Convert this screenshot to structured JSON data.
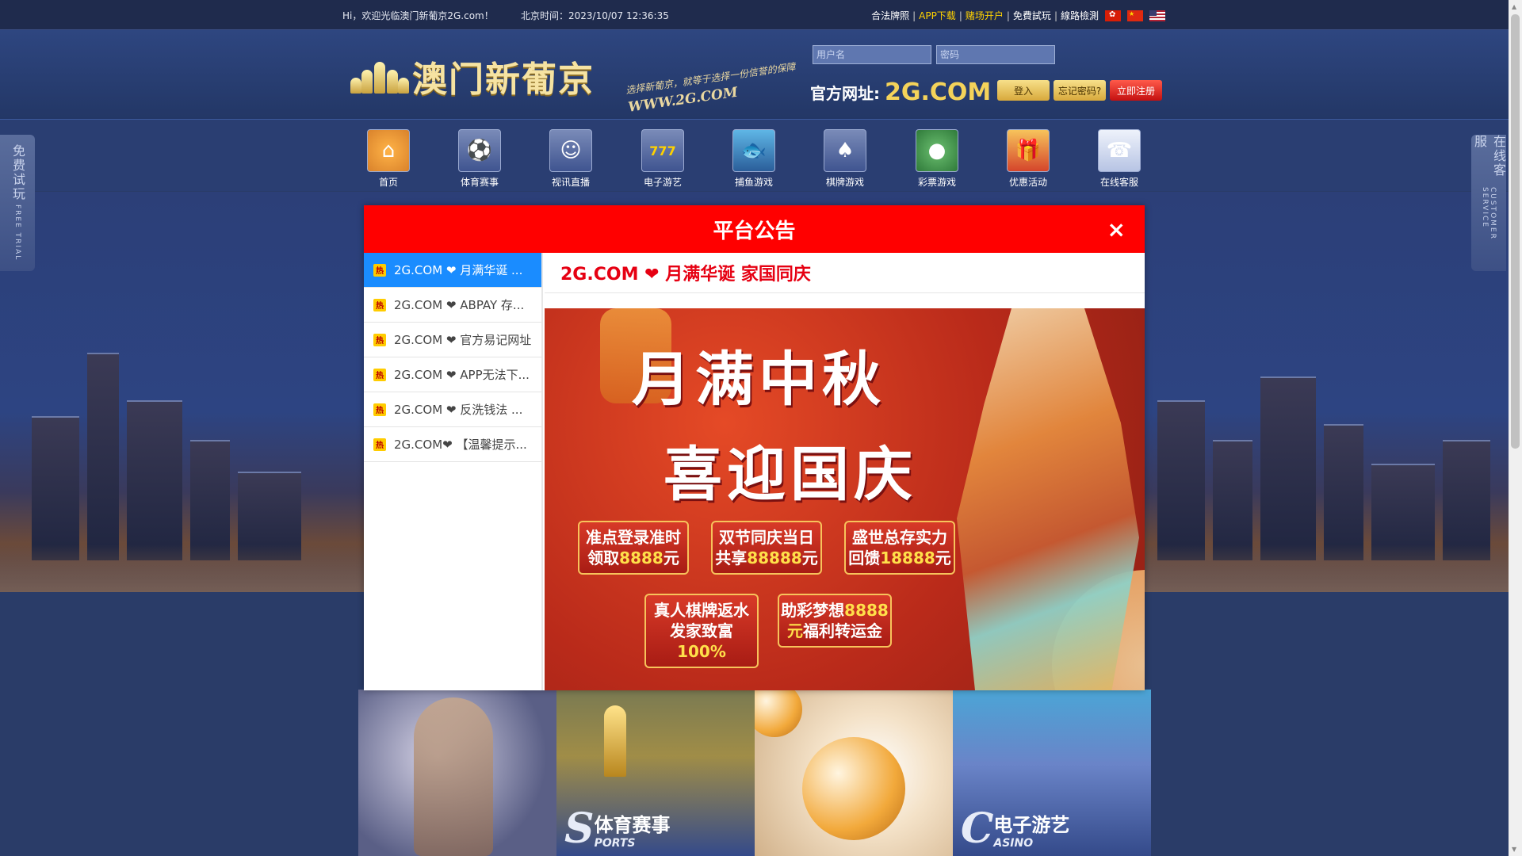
{
  "topbar": {
    "welcome": "Hi，欢迎光临澳门新葡京2G.com！",
    "time": "北京时间：2023/10/07 12:36:35",
    "links": [
      {
        "label": "合法牌照",
        "highlight": false
      },
      {
        "label": "APP下载",
        "highlight": true
      },
      {
        "label": "赌场开户",
        "highlight": true
      },
      {
        "label": "免費試玩",
        "highlight": false
      },
      {
        "label": "線路檢測",
        "highlight": false
      }
    ],
    "separator": "|"
  },
  "header": {
    "logo_text": "澳门新葡京",
    "slogan": "选择新葡京，就等于选择一份信誉的保障",
    "slogan_url": "WWW.2G.COM",
    "username_placeholder": "用户名",
    "password_placeholder": "密码",
    "official_label": "官方网址:",
    "official_domain": "2G.COM",
    "login_btn": "登入",
    "forgot_btn": "忘记密码?",
    "register_btn": "立即注册"
  },
  "nav": [
    {
      "label": "首页",
      "icon": "home-icon"
    },
    {
      "label": "体育赛事",
      "icon": "sports-icon"
    },
    {
      "label": "视讯直播",
      "icon": "live-video-icon"
    },
    {
      "label": "电子游艺",
      "icon": "slot-machine-icon"
    },
    {
      "label": "捕鱼游戏",
      "icon": "fishing-icon"
    },
    {
      "label": "棋牌游戏",
      "icon": "cards-icon"
    },
    {
      "label": "彩票游戏",
      "icon": "lottery-icon"
    },
    {
      "label": "优惠活动",
      "icon": "gift-icon"
    },
    {
      "label": "在线客服",
      "icon": "customer-service-icon"
    }
  ],
  "side": {
    "left_cn": "免费试玩",
    "left_en": "FREE TRIAL",
    "right_cn": "在线客服",
    "right_en": "CUSTOMER SERVICE"
  },
  "modal": {
    "title": "平台公告",
    "close": "×",
    "hot_badge": "热",
    "items": [
      "2G.COM ❤ 月满华诞 ...",
      "2G.COM ❤ ABPAY 存...",
      "2G.COM ❤ 官方易记网址",
      "2G.COM ❤ APP无法下...",
      "2G.COM ❤ 反洗钱法 ...",
      "2G.COM❤ 【温馨提示..."
    ],
    "content_title": "2G.COM ❤ 月满华诞 家国同庆",
    "banner": {
      "line1": "月满中秋",
      "line2": "喜迎国庆",
      "promos": [
        {
          "a": "准点登录准时",
          "b1": "领取",
          "b2": "8888",
          "b3": "元"
        },
        {
          "a": "双节同庆当日",
          "b1": "共享",
          "b2": "88888",
          "b3": "元"
        },
        {
          "a": "盛世总存实力",
          "b1": "回馈",
          "b2": "18888",
          "b3": "元"
        },
        {
          "a": "真人棋牌返水",
          "b1": "发家致富",
          "b2": "100%",
          "b3": ""
        },
        {
          "a": "助彩梦想",
          "a2": "8888",
          "b1": "元",
          "b2": "福利转运金",
          "b3": ""
        }
      ]
    }
  },
  "tiles": [
    {
      "letter": "",
      "cn": "",
      "en": ""
    },
    {
      "letter": "S",
      "cn": "体育赛事",
      "en": "PORTS"
    },
    {
      "letter": "",
      "cn": "",
      "en": ""
    },
    {
      "letter": "C",
      "cn": "电子游艺",
      "en": "ASINO"
    }
  ],
  "colors": {
    "modal_header": "#ff0000",
    "active_item": "#1a8cff",
    "content_title": "#e60012",
    "gold": "#f4d35a"
  }
}
